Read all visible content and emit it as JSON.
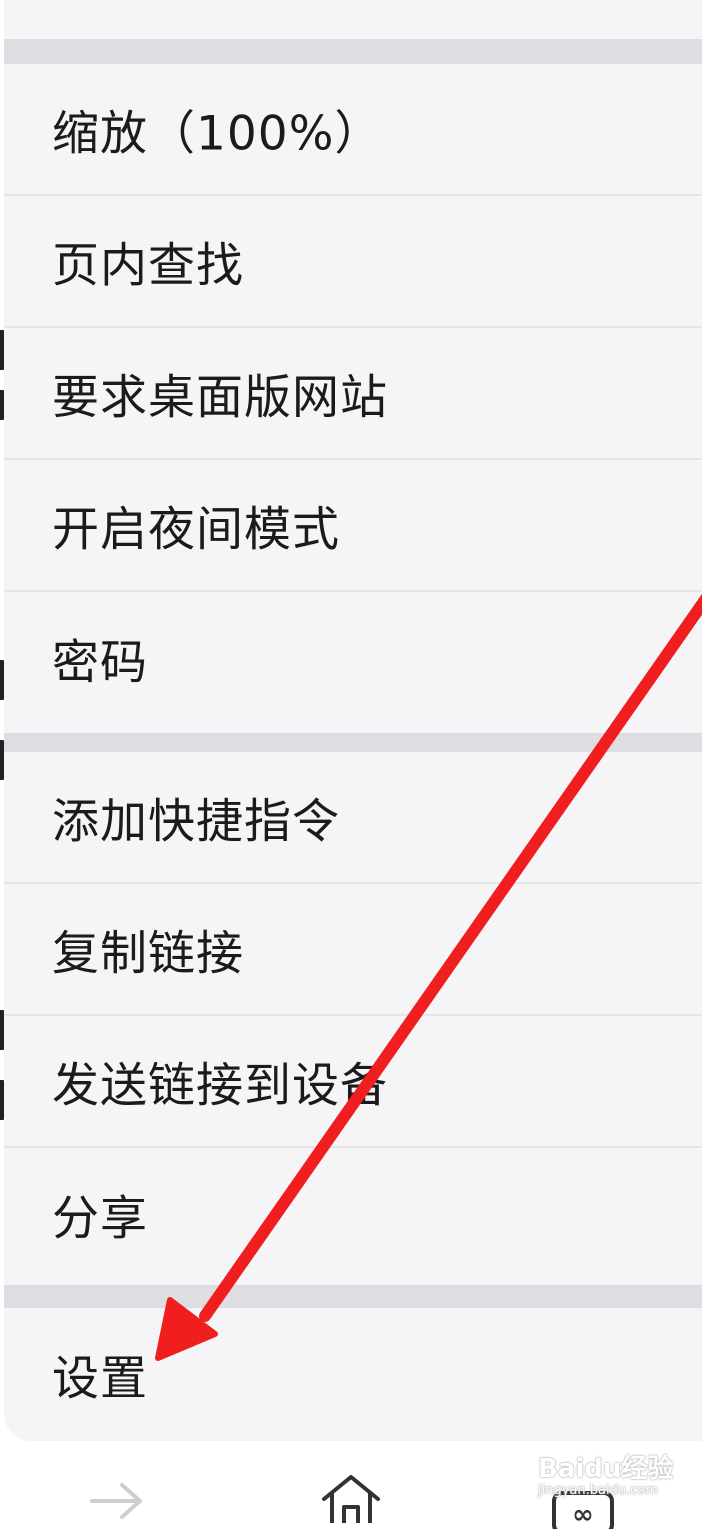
{
  "menu": {
    "group_1": [
      {
        "label": "缩放（100%）"
      },
      {
        "label": "页内查找"
      },
      {
        "label": "要求桌面版网站"
      },
      {
        "label": "开启夜间模式"
      },
      {
        "label": "密码"
      }
    ],
    "group_2": [
      {
        "label": "添加快捷指令"
      },
      {
        "label": "复制链接"
      },
      {
        "label": "发送链接到设备"
      },
      {
        "label": "分享"
      }
    ],
    "group_3": [
      {
        "label": "设置"
      }
    ]
  },
  "toolbar": {
    "icons": [
      "forward-icon",
      "home-icon",
      "tabs-icon"
    ],
    "tabs_badge": "∞"
  },
  "watermark": {
    "text": "Baidu经验",
    "sub": "jingyan.baidu.com"
  },
  "colors": {
    "sheet_bg": "#f5f5f8",
    "divider": "#dedde2",
    "arrow": "#f01e1e",
    "text": "#1b1b1b"
  }
}
